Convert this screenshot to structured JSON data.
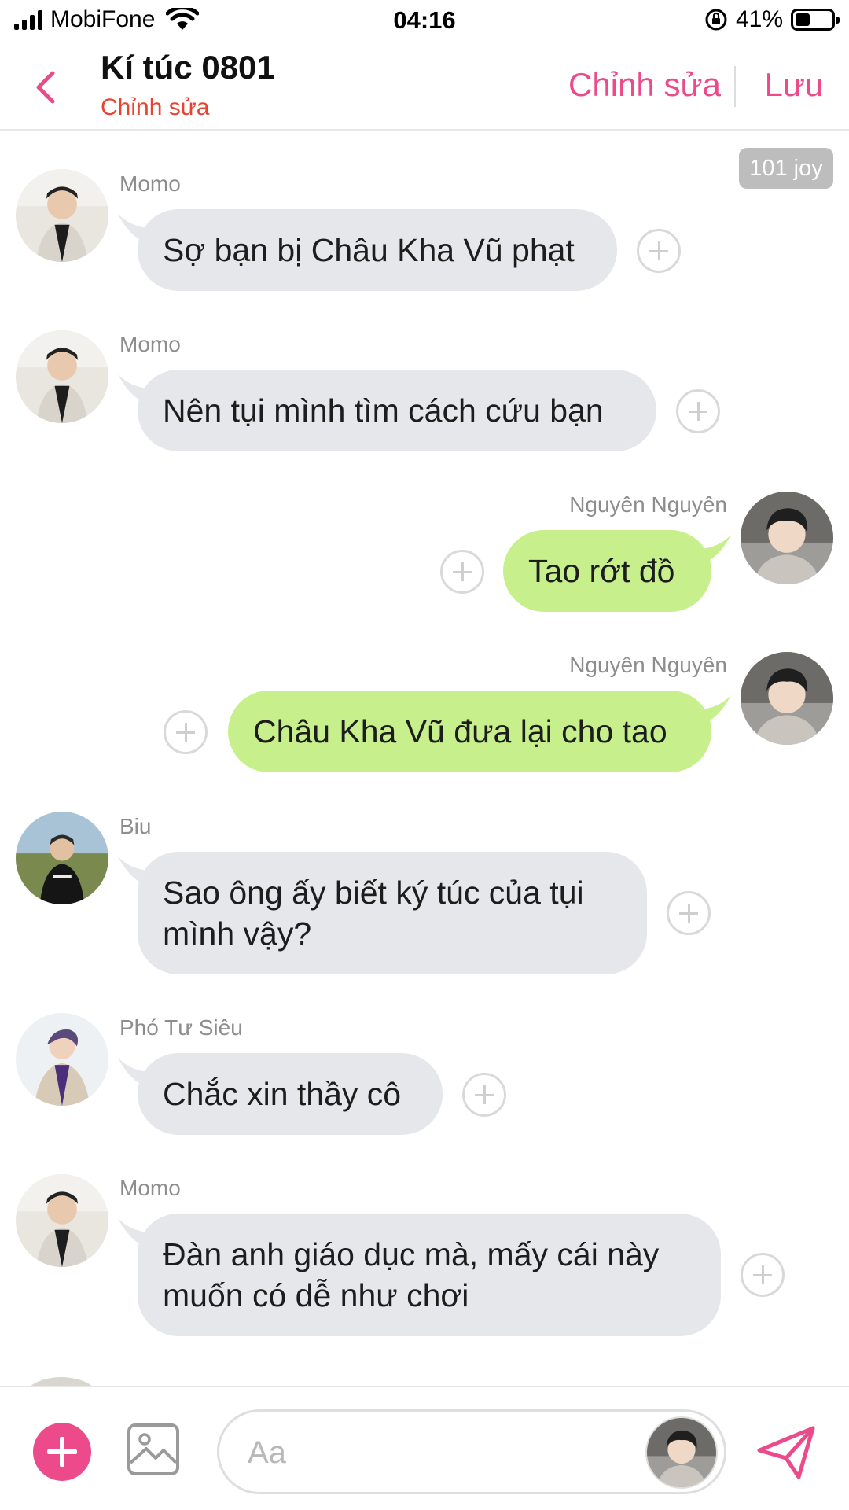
{
  "status_bar": {
    "carrier": "MobiFone",
    "time": "04:16",
    "battery_percent": "41%",
    "battery_level": 0.41
  },
  "header": {
    "title": "Kí túc 0801",
    "subtitle": "Chỉnh sửa",
    "edit_label": "Chỉnh sửa",
    "save_label": "Lưu"
  },
  "joy_badge": "101 joy",
  "messages": [
    {
      "sender": "Momo",
      "text": "Sợ bạn bị Châu Kha Vũ phạt",
      "side": "left"
    },
    {
      "sender": "Momo",
      "text": "Nên tụi mình tìm cách cứu bạn",
      "side": "left"
    },
    {
      "sender": "Nguyên Nguyên",
      "text": "Tao rớt đồ",
      "side": "right"
    },
    {
      "sender": "Nguyên Nguyên",
      "text": "Châu Kha Vũ đưa lại cho tao",
      "side": "right"
    },
    {
      "sender": "Biu",
      "text": "Sao ông ấy biết ký túc của tụi mình vậy?",
      "side": "left"
    },
    {
      "sender": "Phó Tư Siêu",
      "text": "Chắc xin thầy cô",
      "side": "left"
    },
    {
      "sender": "Momo",
      "text": "Đàn anh giáo dục mà, mấy cái này muốn có dễ như chơi",
      "side": "left"
    }
  ],
  "input": {
    "placeholder": "Aa",
    "value": ""
  },
  "icons": {
    "back": "chevron-left-icon",
    "add": "plus-circle-icon",
    "image": "image-icon",
    "send": "paper-plane-icon",
    "react": "plus-outline-icon"
  },
  "colors": {
    "accent": "#ec4a8a",
    "subtitle": "#e8432f",
    "bubble_left": "#e5e7ea",
    "bubble_right": "#c7f08c"
  }
}
